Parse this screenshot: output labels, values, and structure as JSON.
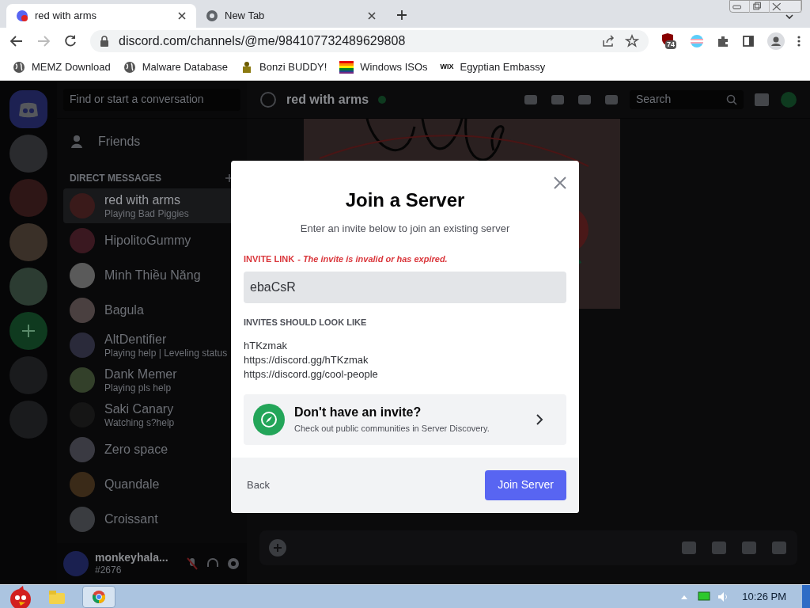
{
  "browser": {
    "tabs": [
      {
        "title": "red with arms",
        "selected": true
      },
      {
        "title": "New Tab",
        "selected": false
      }
    ],
    "url": "discord.com/channels/@me/984107732489629808",
    "extension_badge": "74",
    "bookmarks": [
      {
        "kind": "globe",
        "label": "MEMZ Download"
      },
      {
        "kind": "globe",
        "label": "Malware Database"
      },
      {
        "kind": "figure",
        "label": "Bonzi BUDDY!"
      },
      {
        "kind": "flag",
        "label": "Windows ISOs"
      },
      {
        "kind": "wordmark",
        "mark": "WIX",
        "label": "Egyptian Embassy"
      }
    ]
  },
  "discord": {
    "search_placeholder": "Find or start a conversation",
    "friends": "Friends",
    "dm_header": "DIRECT MESSAGES",
    "dms": [
      {
        "name": "red with arms",
        "status": "Playing Bad Piggies",
        "selected": true
      },
      {
        "name": "HipolitoGummy",
        "selected": false
      },
      {
        "name": "Minh Thiều Năng",
        "selected": false
      },
      {
        "name": "Bagula",
        "selected": false
      },
      {
        "name": "AltDentifier",
        "status": "Playing help | Leveling status",
        "selected": false
      },
      {
        "name": "Dank Memer",
        "status": "Playing pls help",
        "selected": false
      },
      {
        "name": "Saki Canary",
        "status": "Watching s?help",
        "selected": false
      },
      {
        "name": "Zero space",
        "selected": false
      },
      {
        "name": "Quandale",
        "selected": false
      },
      {
        "name": "Croissant",
        "selected": false
      }
    ],
    "user": {
      "name": "monkeyhala...",
      "tag": "#2676"
    },
    "channel": {
      "name": "red with arms"
    },
    "header_search_placeholder": "Search"
  },
  "modal": {
    "title": "Join a Server",
    "subtitle": "Enter an invite below to join an existing server",
    "label": "INVITE LINK",
    "error": "- The invite is invalid or has expired.",
    "value": "ebaCsR",
    "examples_heading": "INVITES SHOULD LOOK LIKE",
    "examples": [
      "hTKzmak",
      "https://discord.gg/hTKzmak",
      "https://discord.gg/cool-people"
    ],
    "discovery": {
      "title": "Don't have an invite?",
      "subtitle": "Check out public communities in Server Discovery."
    },
    "back": "Back",
    "submit": "Join Server"
  },
  "taskbar": {
    "time": "10:26 PM"
  }
}
